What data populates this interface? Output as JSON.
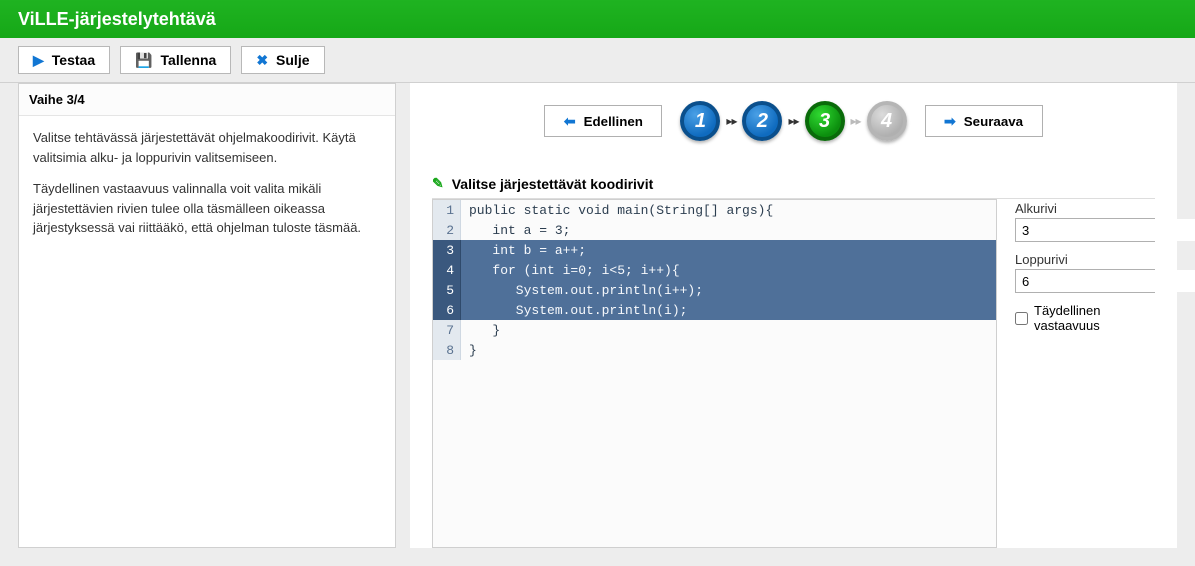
{
  "header": {
    "title": "ViLLE-järjestelytehtävä"
  },
  "toolbar": {
    "test_label": "Testaa",
    "save_label": "Tallenna",
    "close_label": "Sulje"
  },
  "left": {
    "step_title": "Vaihe 3/4",
    "para1": "Valitse tehtävässä järjestettävät ohjelmakoodirivit. Käytä valitsimia alku- ja loppurivin valitsemiseen.",
    "para2": "Täydellinen vastaavuus valinnalla voit valita mikäli järjestettävien rivien tulee olla täsmälleen oikeassa järjestyksessä vai riittääkö, että ohjelman tuloste täsmää."
  },
  "wizard": {
    "prev_label": "Edellinen",
    "next_label": "Seuraava",
    "steps": [
      "1",
      "2",
      "3",
      "4"
    ],
    "current": 3
  },
  "section": {
    "title": "Valitse järjestettävät koodirivit"
  },
  "code": {
    "lines": [
      "public static void main(String[] args){",
      "   int a = 3;",
      "   int b = a++;",
      "   for (int i=0; i<5; i++){",
      "      System.out.println(i++);",
      "      System.out.println(i);",
      "   }",
      "}"
    ],
    "selection_start": 3,
    "selection_end": 6
  },
  "controls": {
    "start_label": "Alkurivi",
    "start_value": "3",
    "end_label": "Loppurivi",
    "end_value": "6",
    "full_match_label": "Täydellinen vastaavuus",
    "full_match_checked": false
  }
}
